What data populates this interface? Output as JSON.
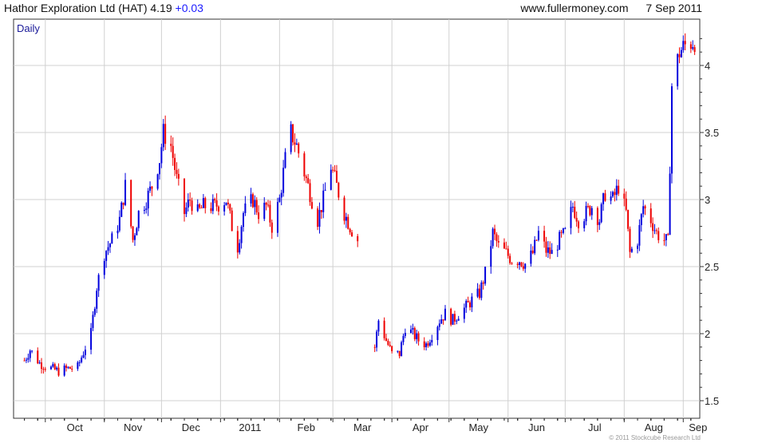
{
  "header": {
    "title": "Hathor Exploration Ltd (HAT)",
    "last": "4.19",
    "change": "+0.03",
    "site": "www.fullermoney.com",
    "date": "7 Sep 2011"
  },
  "footer": {
    "copyright": "© 2011 Stockcube Research Ltd"
  },
  "colors": {
    "up": "#0000dd",
    "down": "#ee0000",
    "grid": "#d0d0d0",
    "frame": "#333333",
    "background": "#ffffff"
  },
  "chart_data": {
    "type": "candlestick",
    "label": "Daily",
    "y_ticks": [
      1.5,
      2,
      2.5,
      3,
      3.5,
      4
    ],
    "ylim": [
      1.4,
      4.3
    ],
    "x_ticks": [
      "Oct",
      "Nov",
      "Dec",
      "2011",
      "Feb",
      "Mar",
      "Apr",
      "May",
      "Jun",
      "Jul",
      "Aug",
      "Sep"
    ],
    "grid": true,
    "series": [
      {
        "name": "HAT",
        "segments": [
          {
            "from": "2010-09-20",
            "to": "2011-03-14",
            "points": [
              [
                "2010-09-20",
                1.8
              ],
              [
                "2010-09-23",
                1.88
              ],
              [
                "2010-09-28",
                1.78
              ],
              [
                "2010-10-04",
                1.74
              ],
              [
                "2010-10-08",
                1.72
              ],
              [
                "2010-10-13",
                1.74
              ],
              [
                "2010-10-18",
                1.75
              ],
              [
                "2010-10-22",
                1.9
              ],
              [
                "2010-10-25",
                2.0
              ],
              [
                "2010-10-28",
                2.35
              ],
              [
                "2010-11-01",
                2.6
              ],
              [
                "2010-11-05",
                2.7
              ],
              [
                "2010-11-09",
                2.85
              ],
              [
                "2010-11-12",
                3.1
              ],
              [
                "2010-11-16",
                2.7
              ],
              [
                "2010-11-19",
                2.9
              ],
              [
                "2010-11-23",
                3.0
              ],
              [
                "2010-11-26",
                3.1
              ],
              [
                "2010-11-30",
                3.3
              ],
              [
                "2010-12-02",
                3.5
              ],
              [
                "2010-12-06",
                3.4
              ],
              [
                "2010-12-09",
                3.15
              ],
              [
                "2010-12-13",
                2.9
              ],
              [
                "2010-12-16",
                3.0
              ],
              [
                "2010-12-20",
                2.9
              ],
              [
                "2010-12-23",
                2.95
              ],
              [
                "2010-12-29",
                2.95
              ],
              [
                "2011-01-04",
                3.0
              ],
              [
                "2011-01-07",
                2.8
              ],
              [
                "2011-01-10",
                2.65
              ],
              [
                "2011-01-13",
                2.9
              ],
              [
                "2011-01-18",
                3.0
              ],
              [
                "2011-01-21",
                2.9
              ],
              [
                "2011-01-25",
                2.95
              ],
              [
                "2011-01-28",
                2.8
              ],
              [
                "2011-02-01",
                3.0
              ],
              [
                "2011-02-04",
                3.3
              ],
              [
                "2011-02-07",
                3.5
              ],
              [
                "2011-02-10",
                3.4
              ],
              [
                "2011-02-14",
                3.2
              ],
              [
                "2011-02-17",
                3.05
              ],
              [
                "2011-02-21",
                2.85
              ],
              [
                "2011-02-24",
                3.0
              ],
              [
                "2011-02-28",
                3.25
              ],
              [
                "2011-03-03",
                3.1
              ],
              [
                "2011-03-07",
                2.9
              ],
              [
                "2011-03-10",
                2.8
              ],
              [
                "2011-03-14",
                2.7
              ]
            ]
          },
          {
            "from": "2011-03-23",
            "to": "2011-09-07",
            "points": [
              [
                "2011-03-23",
                1.9
              ],
              [
                "2011-03-25",
                2.1
              ],
              [
                "2011-03-29",
                1.95
              ],
              [
                "2011-04-01",
                1.85
              ],
              [
                "2011-04-05",
                1.85
              ],
              [
                "2011-04-08",
                2.05
              ],
              [
                "2011-04-12",
                2.0
              ],
              [
                "2011-04-15",
                1.95
              ],
              [
                "2011-04-19",
                1.92
              ],
              [
                "2011-04-26",
                2.1
              ],
              [
                "2011-04-29",
                2.15
              ],
              [
                "2011-05-03",
                2.1
              ],
              [
                "2011-05-06",
                2.15
              ],
              [
                "2011-05-10",
                2.2
              ],
              [
                "2011-05-13",
                2.25
              ],
              [
                "2011-05-17",
                2.3
              ],
              [
                "2011-05-20",
                2.45
              ],
              [
                "2011-05-24",
                2.75
              ],
              [
                "2011-05-27",
                2.65
              ],
              [
                "2011-05-31",
                2.6
              ],
              [
                "2011-06-03",
                2.55
              ],
              [
                "2011-06-07",
                2.55
              ],
              [
                "2011-06-10",
                2.52
              ],
              [
                "2011-06-14",
                2.6
              ],
              [
                "2011-06-17",
                2.75
              ],
              [
                "2011-06-21",
                2.62
              ],
              [
                "2011-06-24",
                2.6
              ],
              [
                "2011-06-28",
                2.7
              ],
              [
                "2011-07-01",
                2.75
              ],
              [
                "2011-07-05",
                2.95
              ],
              [
                "2011-07-08",
                2.85
              ],
              [
                "2011-07-12",
                2.9
              ],
              [
                "2011-07-15",
                2.95
              ],
              [
                "2011-07-19",
                2.85
              ],
              [
                "2011-07-22",
                3.05
              ],
              [
                "2011-07-26",
                3.0
              ],
              [
                "2011-07-29",
                3.1
              ],
              [
                "2011-08-02",
                2.9
              ],
              [
                "2011-08-04",
                2.6
              ],
              [
                "2011-08-08",
                2.7
              ],
              [
                "2011-08-11",
                2.95
              ],
              [
                "2011-08-15",
                2.85
              ],
              [
                "2011-08-18",
                2.75
              ],
              [
                "2011-08-22",
                2.7
              ],
              [
                "2011-08-24",
                2.68
              ],
              [
                "2011-08-26",
                3.85
              ],
              [
                "2011-08-30",
                4.1
              ],
              [
                "2011-09-02",
                4.15
              ],
              [
                "2011-09-07",
                4.19
              ]
            ]
          }
        ]
      }
    ]
  }
}
